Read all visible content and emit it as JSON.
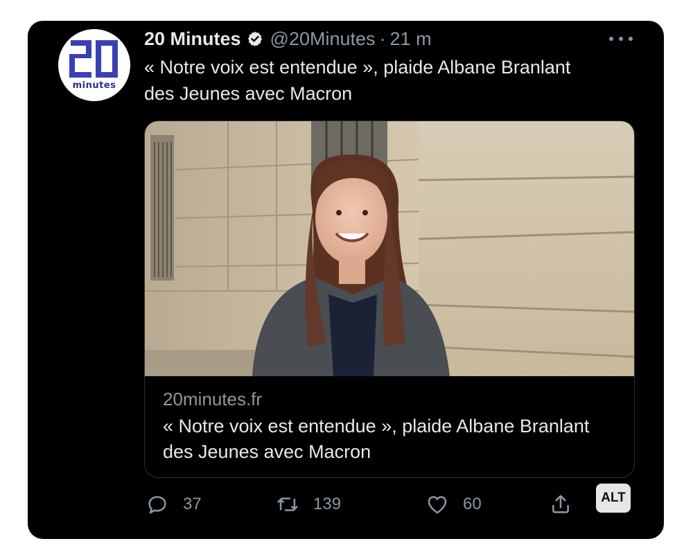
{
  "tweet": {
    "author_name": "20 Minutes",
    "handle": "@20Minutes",
    "separator": "·",
    "time_ago": "21 m",
    "text": "« Notre voix est entendue », plaide Albane Branlant des Jeunes avec Macron",
    "avatar": {
      "logo_number": "20",
      "logo_word": "minutes"
    },
    "verified_icon": "verified-badge-icon",
    "more_icon": "more-options-icon"
  },
  "link_card": {
    "domain": "20minutes.fr",
    "title": "« Notre voix est entendue », plaide Albane Branlant des Jeunes avec Macron",
    "image_description_icon": "article-photo"
  },
  "actions": {
    "reply": {
      "icon": "reply-icon",
      "count": "37"
    },
    "retweet": {
      "icon": "retweet-icon",
      "count": "139"
    },
    "like": {
      "icon": "heart-icon",
      "count": "60"
    },
    "share": {
      "icon": "share-icon"
    }
  },
  "alt_badge": "ALT",
  "colors": {
    "background": "#000000",
    "primary_text": "#e7e9ea",
    "secondary_text": "#8b98a5",
    "brand_blue": "#2b2f8c"
  }
}
